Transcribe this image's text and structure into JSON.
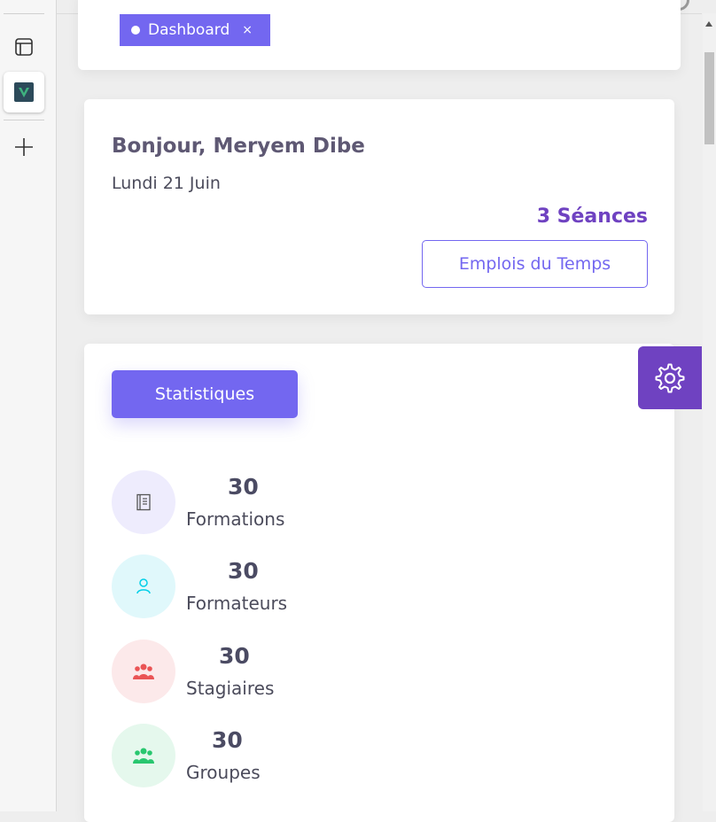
{
  "tabs": [
    {
      "label": "Dashboard",
      "close": "×"
    }
  ],
  "welcome": {
    "greeting": "Bonjour, Meryem Dibe",
    "date": "Lundi 21 Juin",
    "sessions": "3 Séances",
    "timetable_button": "Emplois du Temps"
  },
  "stats": {
    "button": "Statistiques",
    "items": [
      {
        "value": "30",
        "label": "Formations",
        "icon": "book-icon",
        "bg": "#eeecfd",
        "color": "#7367f0"
      },
      {
        "value": "30",
        "label": "Formateurs",
        "icon": "user-icon",
        "bg": "#e0f8fb",
        "color": "#00cfe8"
      },
      {
        "value": "30",
        "label": "Stagiaires",
        "icon": "users-icon",
        "bg": "#fce9ea",
        "color": "#ea5455"
      },
      {
        "value": "30",
        "label": "Groupes",
        "icon": "users-icon",
        "bg": "#e5f8ed",
        "color": "#28c76f"
      }
    ]
  },
  "colors": {
    "primary": "#7367f0",
    "accent": "#6f42c1"
  }
}
